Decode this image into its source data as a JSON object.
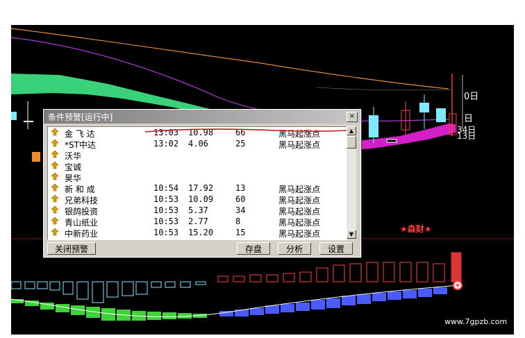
{
  "dialog": {
    "title": "条件预警[运行中]",
    "close_glyph": "×",
    "rows": [
      {
        "name": "金 飞 达",
        "time": "13:03",
        "price": "10.98",
        "change": "66",
        "signal": "黑马起涨点"
      },
      {
        "name": "*ST中达",
        "time": "13:02",
        "price": "4.06",
        "change": "25",
        "signal": "黑马起涨点"
      },
      {
        "name": "沃华",
        "time": "",
        "price": "",
        "change": "",
        "signal": ""
      },
      {
        "name": "宝诚",
        "time": "",
        "price": "",
        "change": "",
        "signal": ""
      },
      {
        "name": "昊华",
        "time": "",
        "price": "",
        "change": "",
        "signal": ""
      },
      {
        "name": "新 和 成",
        "time": "10:54",
        "price": "17.92",
        "change": "13",
        "signal": "黑马起涨点"
      },
      {
        "name": "兄弟科技",
        "time": "10:53",
        "price": "10.09",
        "change": "60",
        "signal": "黑马起涨点"
      },
      {
        "name": "银鸽投资",
        "time": "10:53",
        "price": "5.37",
        "change": "34",
        "signal": "黑马起涨点"
      },
      {
        "name": "青山纸业",
        "time": "10:53",
        "price": "2.77",
        "change": "8",
        "signal": "黑马起涨点"
      },
      {
        "name": "中新药业",
        "time": "10:53",
        "price": "15.20",
        "change": "15",
        "signal": "黑马起涨点"
      }
    ],
    "buttons": {
      "close_alert": "关闭预警",
      "save": "存盘",
      "analyze": "分析",
      "settings": "设置"
    }
  },
  "chart": {
    "right_labels": [
      "0日",
      "日",
      "34日",
      "13日"
    ],
    "star_label": "★森财★",
    "watermark": "www.7gpzb.com",
    "colors": {
      "background": "#000000",
      "green_band": "#39d27a",
      "magenta_band": "#d21fc8",
      "up_candle": "#ff4040",
      "cyan_candle": "#7fe9ff",
      "blue_bars": "#4a5cff",
      "green_bars": "#3fd23a"
    }
  }
}
